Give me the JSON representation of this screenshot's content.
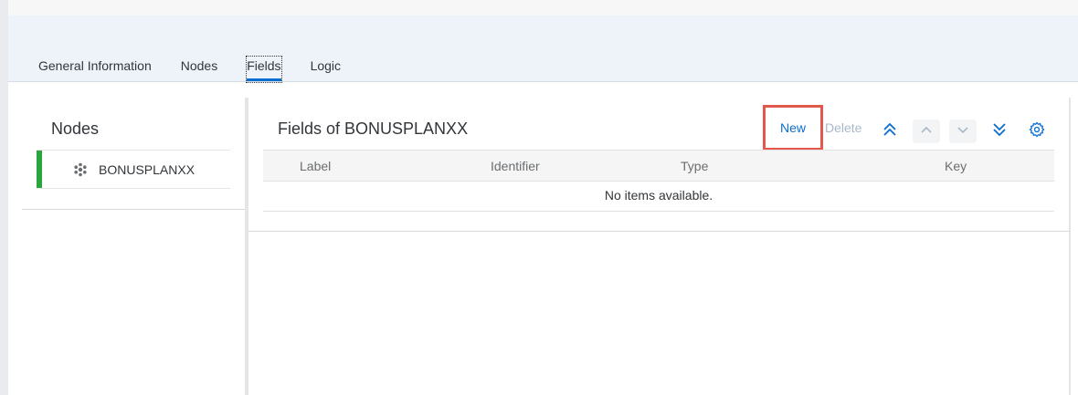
{
  "tabs": [
    {
      "label": "General Information"
    },
    {
      "label": "Nodes"
    },
    {
      "label": "Fields"
    },
    {
      "label": "Logic"
    }
  ],
  "nodes_panel": {
    "title": "Nodes",
    "items": [
      {
        "label": "BONUSPLANXX",
        "icon": "node-cluster-icon",
        "accent": "#2ba43b"
      }
    ]
  },
  "fields_panel": {
    "title": "Fields of BONUSPLANXX",
    "toolbar": {
      "new_label": "New",
      "delete_label": "Delete",
      "icons": [
        "move-to-top-icon",
        "move-up-icon",
        "move-down-icon",
        "move-to-bottom-icon",
        "settings-gear-icon"
      ]
    },
    "table": {
      "columns": [
        "Label",
        "Identifier",
        "Type",
        "Key"
      ],
      "empty_text": "No items available."
    }
  },
  "colors": {
    "accent": "#0a6ed1",
    "highlight": "#e3584c",
    "node_accent": "#2ba43b"
  }
}
